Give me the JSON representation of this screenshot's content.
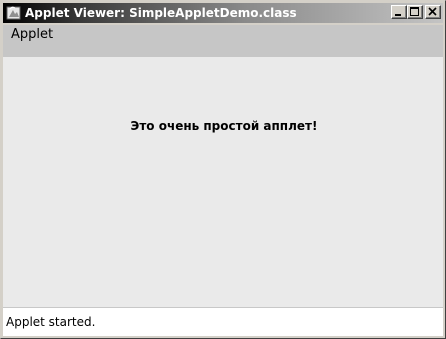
{
  "window": {
    "title": "Applet Viewer: SimpleAppletDemo.class",
    "icon": "java-applet-icon",
    "controls": [
      "minimize-icon",
      "maximize-icon",
      "close-icon"
    ]
  },
  "menubar": {
    "items": [
      {
        "label": "Applet"
      }
    ]
  },
  "applet": {
    "message": "Это очень простой апплет!"
  },
  "status": {
    "text": "Applet started."
  },
  "colors": {
    "titlebar_start": "#000000",
    "titlebar_end": "#c4c4c4",
    "applet_background": "#eaeaea",
    "menubar_background": "#c6c6c6",
    "status_background": "#ffffff"
  }
}
